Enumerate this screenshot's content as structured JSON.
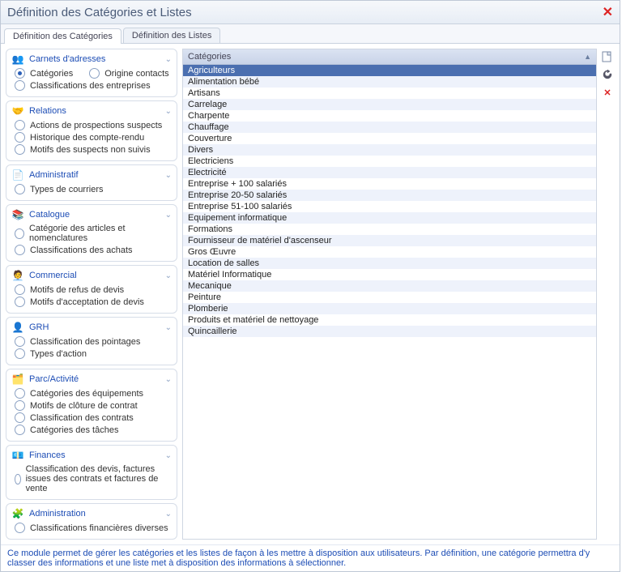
{
  "window": {
    "title": "Définition des Catégories et Listes"
  },
  "tabs": [
    {
      "label": "Définition des Catégories",
      "active": true
    },
    {
      "label": "Définition des Listes",
      "active": false
    }
  ],
  "sidebar_groups": [
    {
      "title": "Carnets d'adresses",
      "icon": "users-icon",
      "icon_glyph": "👥",
      "options": [
        {
          "label": "Catégories",
          "selected": true,
          "inline": true
        },
        {
          "label": "Origine contacts",
          "selected": false,
          "inline": true
        },
        {
          "label": "Classifications des entreprises",
          "selected": false
        }
      ]
    },
    {
      "title": "Relations",
      "icon": "handshake-icon",
      "icon_glyph": "🤝",
      "options": [
        {
          "label": "Actions de prospections suspects",
          "selected": false
        },
        {
          "label": "Historique des compte-rendu",
          "selected": false
        },
        {
          "label": "Motifs des suspects non suivis",
          "selected": false
        }
      ]
    },
    {
      "title": "Administratif",
      "icon": "document-icon",
      "icon_glyph": "📄",
      "options": [
        {
          "label": "Types de courriers",
          "selected": false
        }
      ]
    },
    {
      "title": "Catalogue",
      "icon": "catalog-icon",
      "icon_glyph": "📚",
      "options": [
        {
          "label": "Catégorie des articles et nomenclatures",
          "selected": false
        },
        {
          "label": "Classifications des achats",
          "selected": false
        }
      ]
    },
    {
      "title": "Commercial",
      "icon": "commercial-icon",
      "icon_glyph": "🧑‍💼",
      "options": [
        {
          "label": "Motifs de refus de devis",
          "selected": false
        },
        {
          "label": "Motifs d'acceptation de devis",
          "selected": false
        }
      ]
    },
    {
      "title": "GRH",
      "icon": "hr-icon",
      "icon_glyph": "👤",
      "options": [
        {
          "label": "Classification des pointages",
          "selected": false
        },
        {
          "label": "Types d'action",
          "selected": false
        }
      ]
    },
    {
      "title": "Parc/Activité",
      "icon": "activity-icon",
      "icon_glyph": "🗂️",
      "options": [
        {
          "label": "Catégories des équipements",
          "selected": false
        },
        {
          "label": "Motifs de clôture de contrat",
          "selected": false
        },
        {
          "label": "Classification des contrats",
          "selected": false
        },
        {
          "label": "Catégories des tâches",
          "selected": false
        }
      ]
    },
    {
      "title": "Finances",
      "icon": "finance-icon",
      "icon_glyph": "💶",
      "options": [
        {
          "label": "Classification des devis, factures issues des contrats et factures de vente",
          "selected": false
        }
      ]
    },
    {
      "title": "Administration",
      "icon": "admin-icon",
      "icon_glyph": "🧩",
      "options": [
        {
          "label": "Classifications financières diverses",
          "selected": false
        }
      ]
    }
  ],
  "list": {
    "header": "Catégories",
    "selected_index": 0,
    "rows": [
      "Agriculteurs",
      "Alimentation bébé",
      "Artisans",
      "Carrelage",
      "Charpente",
      "Chauffage",
      "Couverture",
      "Divers",
      "Electriciens",
      "Electricité",
      "Entreprise + 100 salariés",
      "Entreprise 20-50 salariés",
      "Entreprise 51-100 salariés",
      "Equipement informatique",
      "Formations",
      "Fournisseur de matériel d'ascenseur",
      "Gros Œuvre",
      "Location de salles",
      "Matériel Informatique",
      "Mecanique",
      "Peinture",
      "Plomberie",
      "Produits et matériel de nettoyage",
      "Quincaillerie"
    ]
  },
  "tools": {
    "new": "Nouveau",
    "refresh": "Rafraîchir",
    "delete": "Supprimer"
  },
  "footer": "Ce module permet de gérer les catégories et les listes de façon à les mettre à disposition aux utilisateurs. Par définition, une catégorie permettra d'y classer des informations et une liste met à disposition des informations à sélectionner."
}
